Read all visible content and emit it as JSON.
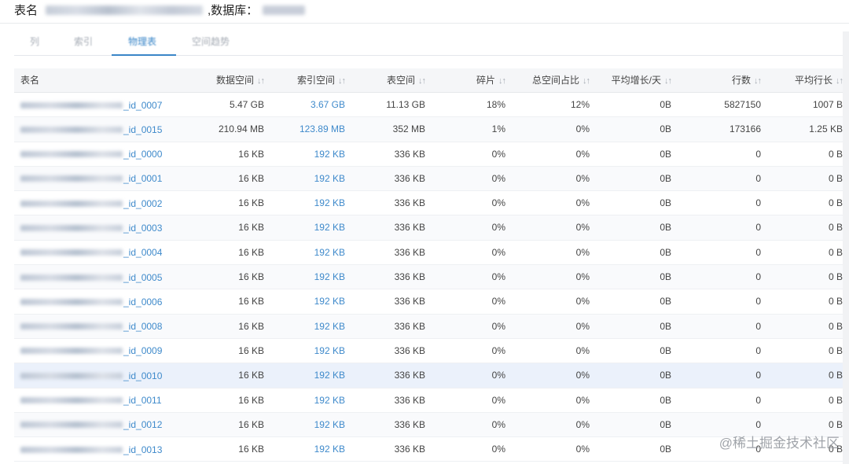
{
  "header": {
    "table_label": "表名",
    "db_label": ",数据库："
  },
  "tabs": [
    "列",
    "索引",
    "物理表",
    "空间趋势"
  ],
  "active_tab": "物理表",
  "columns": {
    "name": "表名",
    "data_space": "数据空间",
    "index_space": "索引空间",
    "table_space": "表空间",
    "fragment": "碎片",
    "space_ratio": "总空间占比",
    "avg_growth": "平均增长/天",
    "rows": "行数",
    "avg_row_len": "平均行长"
  },
  "sort_icon": "sort-icon",
  "rows": [
    {
      "suffix": "_id_0007",
      "data_space": "5.47 GB",
      "index_space": "3.67 GB",
      "table_space": "11.13 GB",
      "fragment": "18%",
      "space_ratio": "12%",
      "avg_growth": "0B",
      "rows": "5827150",
      "avg_row_len": "1007 B"
    },
    {
      "suffix": "_id_0015",
      "data_space": "210.94 MB",
      "index_space": "123.89 MB",
      "table_space": "352 MB",
      "fragment": "1%",
      "space_ratio": "0%",
      "avg_growth": "0B",
      "rows": "173166",
      "avg_row_len": "1.25 KB"
    },
    {
      "suffix": "_id_0000",
      "data_space": "16 KB",
      "index_space": "192 KB",
      "table_space": "336 KB",
      "fragment": "0%",
      "space_ratio": "0%",
      "avg_growth": "0B",
      "rows": "0",
      "avg_row_len": "0 B"
    },
    {
      "suffix": "_id_0001",
      "data_space": "16 KB",
      "index_space": "192 KB",
      "table_space": "336 KB",
      "fragment": "0%",
      "space_ratio": "0%",
      "avg_growth": "0B",
      "rows": "0",
      "avg_row_len": "0 B"
    },
    {
      "suffix": "_id_0002",
      "data_space": "16 KB",
      "index_space": "192 KB",
      "table_space": "336 KB",
      "fragment": "0%",
      "space_ratio": "0%",
      "avg_growth": "0B",
      "rows": "0",
      "avg_row_len": "0 B"
    },
    {
      "suffix": "_id_0003",
      "data_space": "16 KB",
      "index_space": "192 KB",
      "table_space": "336 KB",
      "fragment": "0%",
      "space_ratio": "0%",
      "avg_growth": "0B",
      "rows": "0",
      "avg_row_len": "0 B"
    },
    {
      "suffix": "_id_0004",
      "data_space": "16 KB",
      "index_space": "192 KB",
      "table_space": "336 KB",
      "fragment": "0%",
      "space_ratio": "0%",
      "avg_growth": "0B",
      "rows": "0",
      "avg_row_len": "0 B"
    },
    {
      "suffix": "_id_0005",
      "data_space": "16 KB",
      "index_space": "192 KB",
      "table_space": "336 KB",
      "fragment": "0%",
      "space_ratio": "0%",
      "avg_growth": "0B",
      "rows": "0",
      "avg_row_len": "0 B"
    },
    {
      "suffix": "_id_0006",
      "data_space": "16 KB",
      "index_space": "192 KB",
      "table_space": "336 KB",
      "fragment": "0%",
      "space_ratio": "0%",
      "avg_growth": "0B",
      "rows": "0",
      "avg_row_len": "0 B"
    },
    {
      "suffix": "_id_0008",
      "data_space": "16 KB",
      "index_space": "192 KB",
      "table_space": "336 KB",
      "fragment": "0%",
      "space_ratio": "0%",
      "avg_growth": "0B",
      "rows": "0",
      "avg_row_len": "0 B"
    },
    {
      "suffix": "_id_0009",
      "data_space": "16 KB",
      "index_space": "192 KB",
      "table_space": "336 KB",
      "fragment": "0%",
      "space_ratio": "0%",
      "avg_growth": "0B",
      "rows": "0",
      "avg_row_len": "0 B"
    },
    {
      "suffix": "_id_0010",
      "data_space": "16 KB",
      "index_space": "192 KB",
      "table_space": "336 KB",
      "fragment": "0%",
      "space_ratio": "0%",
      "avg_growth": "0B",
      "rows": "0",
      "avg_row_len": "0 B",
      "highlight": true
    },
    {
      "suffix": "_id_0011",
      "data_space": "16 KB",
      "index_space": "192 KB",
      "table_space": "336 KB",
      "fragment": "0%",
      "space_ratio": "0%",
      "avg_growth": "0B",
      "rows": "0",
      "avg_row_len": "0 B"
    },
    {
      "suffix": "_id_0012",
      "data_space": "16 KB",
      "index_space": "192 KB",
      "table_space": "336 KB",
      "fragment": "0%",
      "space_ratio": "0%",
      "avg_growth": "0B",
      "rows": "0",
      "avg_row_len": "0 B"
    },
    {
      "suffix": "_id_0013",
      "data_space": "16 KB",
      "index_space": "192 KB",
      "table_space": "336 KB",
      "fragment": "0%",
      "space_ratio": "0%",
      "avg_growth": "0B",
      "rows": "0",
      "avg_row_len": "0 B"
    }
  ],
  "watermark": "@稀土掘金技术社区",
  "colors": {
    "link": "#3f8acb",
    "active_tab": "#3a86c8",
    "header_bg": "#f5f6f8",
    "highlight_row": "#ebf1fb"
  }
}
